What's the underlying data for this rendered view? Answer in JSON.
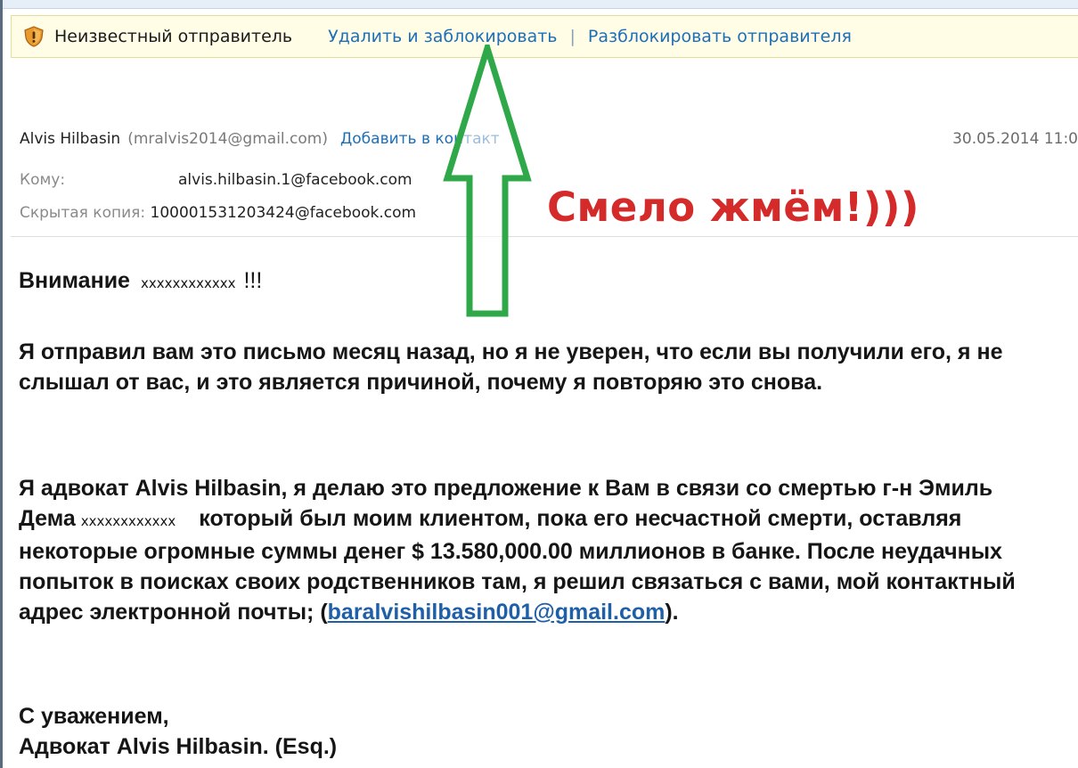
{
  "info_bar": {
    "warning": "Неизвестный отправитель",
    "delete_block": "Удалить и заблокировать",
    "separator": "|",
    "unblock": "Разблокировать отправителя",
    "icon": "shield-warning-icon"
  },
  "header": {
    "sender_name": "Alvis Hilbasin",
    "sender_email": "(mralvis2014@gmail.com)",
    "add_contact": "Добавить в контакт",
    "date": "30.05.2014 11:0",
    "to_label": "Кому:",
    "to_value": "alvis.hilbasin.1@facebook.com",
    "bcc_label": "Скрытая копия:",
    "bcc_value": "100001531203424@facebook.com"
  },
  "body": {
    "attention_word": "Внимание",
    "attention_mask": "xxxxxxxxxxxx",
    "attention_excl": "!!!",
    "paragraph1": "Я отправил вам это письмо месяц назад, но я не уверен, что если вы получили его, я не слышал от вас, и это является причиной, почему я повторяю это снова.",
    "paragraph2_start": "Я адвокат Alvis Hilbasin, я делаю это предложение к Вам в связи со смертью г-н Эмиль Дема",
    "paragraph2_mask": "xxxxxxxxxxxx",
    "paragraph2_mid": "который был моим клиентом, пока его несчастной смерти, оставляя некоторые огромные суммы денег $ 13.580,000.00 миллионов в банке. После неудачных попыток в поисках своих родственников там, я решил связаться с вами, мой контактный адрес электронной почты; (",
    "paragraph2_email": "baralvishilbasin001@gmail.com",
    "paragraph2_end": ").",
    "sign_line1": "С уважением,",
    "sign_line2": "Адвокат Alvis Hilbasin. (Esq.)"
  },
  "annotation": {
    "text": "Смело жмём!)))",
    "arrow_icon": "up-arrow-icon",
    "arrow_color": "#2fa84a",
    "text_color": "#d42a2a"
  },
  "colors": {
    "info_bar_bg": "#fffde6",
    "link": "#1d6fb8",
    "email_link": "#1f5fa8"
  }
}
